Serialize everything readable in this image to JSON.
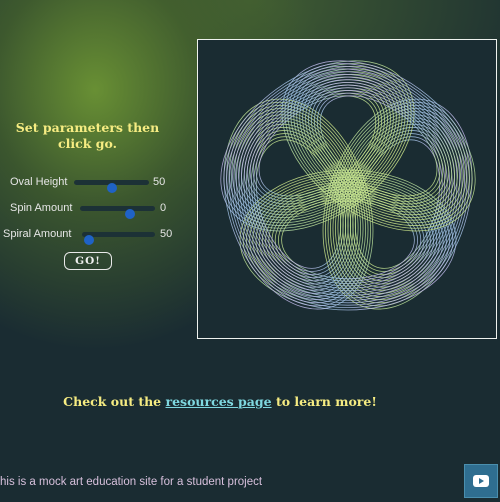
{
  "panel": {
    "title": "Set parameters then click go.",
    "params": [
      {
        "label": "Oval Height",
        "value": "50",
        "fraction": 0.5
      },
      {
        "label": "Spin Amount",
        "value": "0",
        "fraction": 0.66
      },
      {
        "label": "Spiral Amount",
        "value": "50",
        "fraction": 0.1
      }
    ],
    "go_label": "GO!"
  },
  "cta": {
    "prefix": "Check out the",
    "link_text": "resources page",
    "suffix": "to learn more!"
  },
  "footer": {
    "text": "his is a mock art education site for a student project"
  },
  "icons": {
    "video": "video-icon"
  },
  "colors": {
    "accent_yellow": "#f6ec82",
    "link_cyan": "#7fd8e0",
    "slider_thumb": "#1f62c6",
    "background": "#1a2c32"
  }
}
